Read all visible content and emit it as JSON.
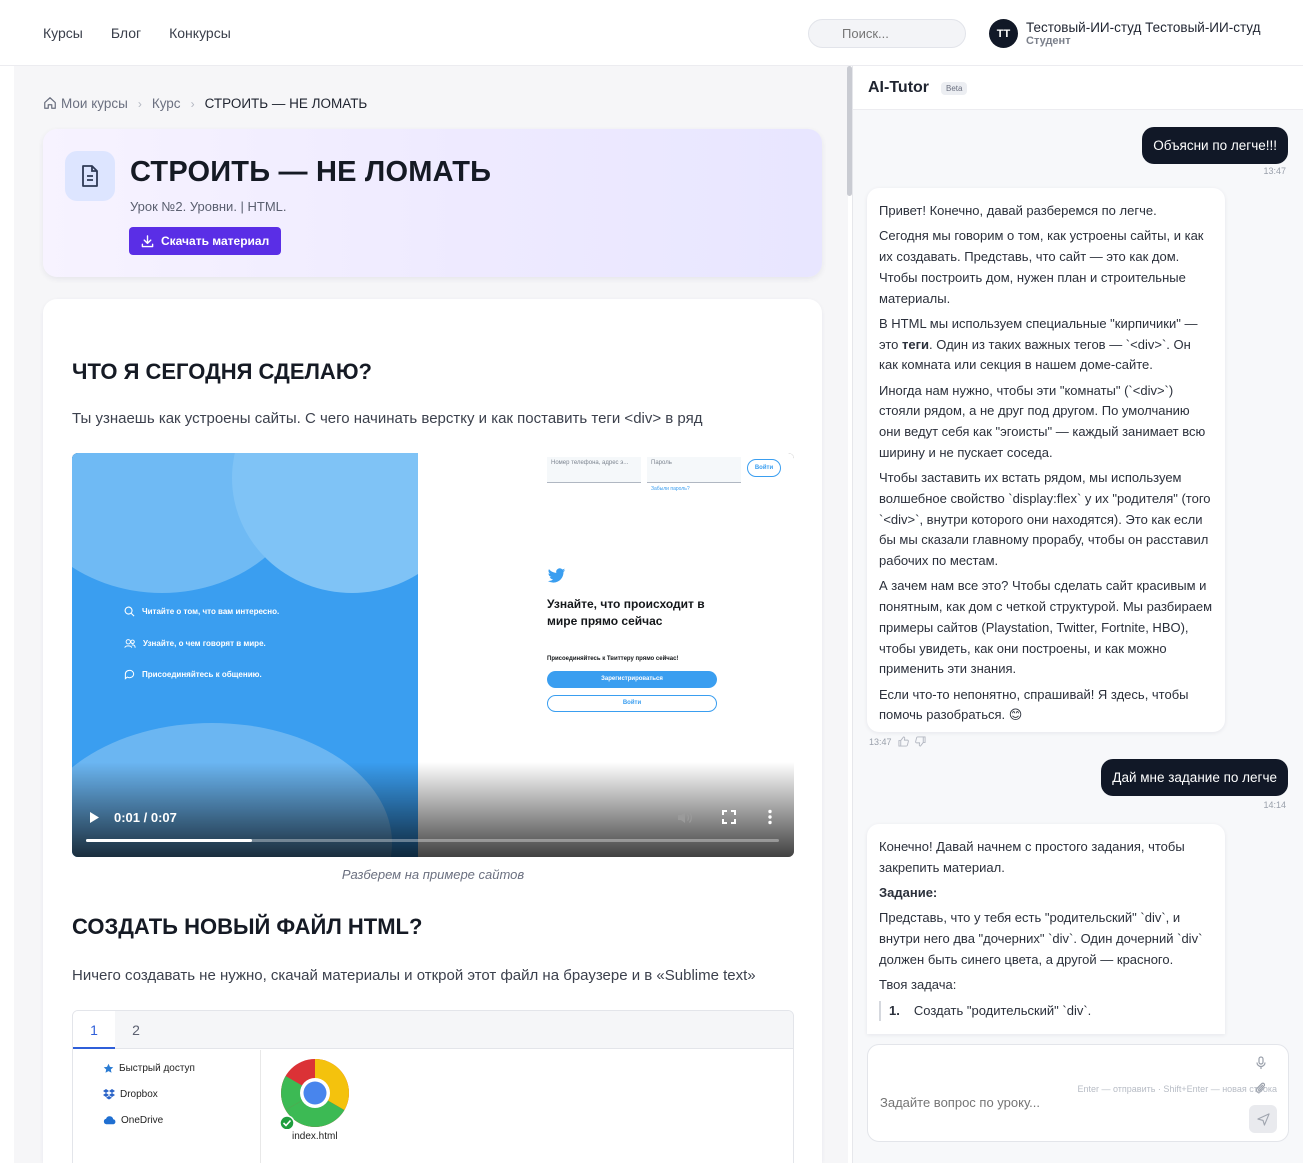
{
  "topnav": {
    "courses": "Курсы",
    "blog": "Блог",
    "contests": "Конкурсы"
  },
  "search": {
    "placeholder": "Поиск..."
  },
  "user": {
    "initials": "ТТ",
    "name": "Тестовый-ИИ-студ Тестовый-ИИ-студ",
    "role": "Студент"
  },
  "breadcrumb": {
    "my_courses": "Мои курсы",
    "course": "Курс",
    "current": "СТРОИТЬ — НЕ ЛОМАТЬ"
  },
  "lesson": {
    "title": "СТРОИТЬ — НЕ ЛОМАТЬ",
    "subtitle": "Урок №2. Уровни. | HTML.",
    "download_label": "Скачать материал"
  },
  "content": {
    "h1": "ЧТО Я СЕГОДНЯ СДЕЛАЮ?",
    "p1": "Ты узнаешь как устроены сайты. С чего начинать верстку и как поставить теги <div> в ряд",
    "video": {
      "time": "0:01 / 0:07",
      "progress_pct": 24,
      "left_items": [
        "Читайте о том, что вам интересно.",
        "Узнайте, о чем говорят в мире.",
        "Присоединяйтесь к общению."
      ],
      "field_phone": "Номер телефона, адрес э...",
      "field_pass": "Пароль",
      "login": "Войти",
      "forgot": "Забыли пароль?",
      "headline": "Узнайте, что происходит в мире прямо сейчас",
      "join": "Присоединяйтесь к Твиттеру прямо сейчас!",
      "register": "Зарегистрироваться",
      "login2": "Войти"
    },
    "caption": "Разберем на примере сайтов",
    "h2": "СОЗДАТЬ НОВЫЙ ФАЙЛ HTML?",
    "p2": "Ничего создавать не нужно, скачай материалы и открой этот файл на браузере и в «Sublime text»",
    "tabs": [
      "1",
      "2"
    ],
    "explorer": {
      "quick": "Быстрый доступ",
      "dropbox": "Dropbox",
      "onedrive": "OneDrive",
      "file": "index.html"
    }
  },
  "tutor": {
    "title": "AI-Tutor",
    "badge": "Beta",
    "msg1": {
      "text": "Объясни по легче!!!",
      "time": "13:47"
    },
    "reply1": {
      "p1": "Привет! Конечно, давай разберемся по легче.",
      "p2": "Сегодня мы говорим о том, как устроены сайты, и как их создавать. Представь, что сайт — это как дом. Чтобы построить дом, нужен план и строительные материалы.",
      "p3a": "В HTML мы используем специальные \"кирпичики\" — это ",
      "p3b": "теги",
      "p3c": ". Один из таких важных тегов — `<div>`. Он как комната или секция в нашем доме-сайте.",
      "p4": "Иногда нам нужно, чтобы эти \"комнаты\" (`<div>`) стояли рядом, а не друг под другом. По умолчанию они ведут себя как \"эгоисты\" — каждый занимает всю ширину и не пускает соседа.",
      "p5": "Чтобы заставить их встать рядом, мы используем волшебное свойство `display:flex` у их \"родителя\" (того `<div>`, внутри которого они находятся). Это как если бы мы сказали главному прорабу, чтобы он расставил рабочих по местам.",
      "p6": "А зачем нам все это? Чтобы сделать сайт красивым и понятным, как дом с четкой структурой. Мы разбираем примеры сайтов (Playstation, Twitter, Fortnite, HBO), чтобы увидеть, как они построены, и как можно применить эти знания.",
      "p7": "Если что-то непонятно, спрашивай! Я здесь, чтобы помочь разобраться. 😊",
      "time": "13:47"
    },
    "msg2": {
      "text": "Дай мне задание по легче",
      "time": "14:14"
    },
    "reply2": {
      "p1": "Конечно! Давай начнем с простого задания, чтобы закрепить материал.",
      "p2": "Задание:",
      "p3": "Представь, что у тебя есть \"родительский\" `div`, и внутри него два \"дочерних\" `div`. Один дочерний `div` должен быть синего цвета, а другой — красного.",
      "p4": "Твоя задача:",
      "li1n": "1.",
      "li1": "Создать \"родительский\" `div`."
    },
    "composer": {
      "placeholder": "Задайте вопрос по уроку..."
    },
    "hint": "Enter — отправить · Shift+Enter — новая строка"
  }
}
